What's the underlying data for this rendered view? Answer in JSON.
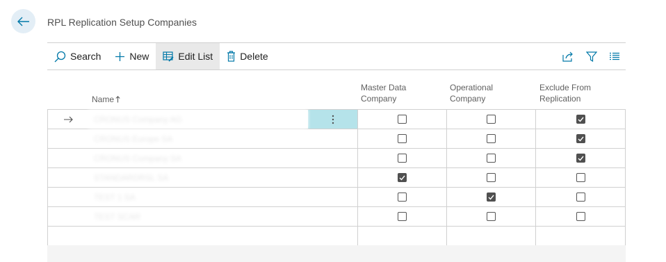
{
  "header": {
    "title": "RPL Replication Setup Companies"
  },
  "actions": {
    "search": "Search",
    "new": "New",
    "edit_list": "Edit List",
    "delete": "Delete"
  },
  "columns": {
    "name": "Name",
    "master_data": [
      "Master Data",
      "Company"
    ],
    "operational": [
      "Operational",
      "Company"
    ],
    "exclude": [
      "Exclude From",
      "Replication"
    ]
  },
  "rows": [
    {
      "name": "CRONUS Company AG",
      "master": false,
      "operational": false,
      "exclude": true
    },
    {
      "name": "CRONUS Europe SA",
      "master": false,
      "operational": false,
      "exclude": true
    },
    {
      "name": "CRONUS Company SA",
      "master": false,
      "operational": false,
      "exclude": true
    },
    {
      "name": "STANDARDRSL SA",
      "master": true,
      "operational": false,
      "exclude": false
    },
    {
      "name": "TEST 1 SA",
      "master": false,
      "operational": true,
      "exclude": false
    },
    {
      "name": "TEST SCAR",
      "master": false,
      "operational": false,
      "exclude": false
    }
  ],
  "colors": {
    "selected_row": "#b5e3ea",
    "back_button": "#e3eef6",
    "accent": "#0078a8"
  },
  "icons": [
    "back-arrow-icon",
    "search-icon",
    "plus-icon",
    "edit-list-icon",
    "delete-icon",
    "share-icon",
    "filter-icon",
    "list-view-icon",
    "row-indicator-arrow-icon",
    "more-options-icon",
    "sort-up-icon"
  ]
}
